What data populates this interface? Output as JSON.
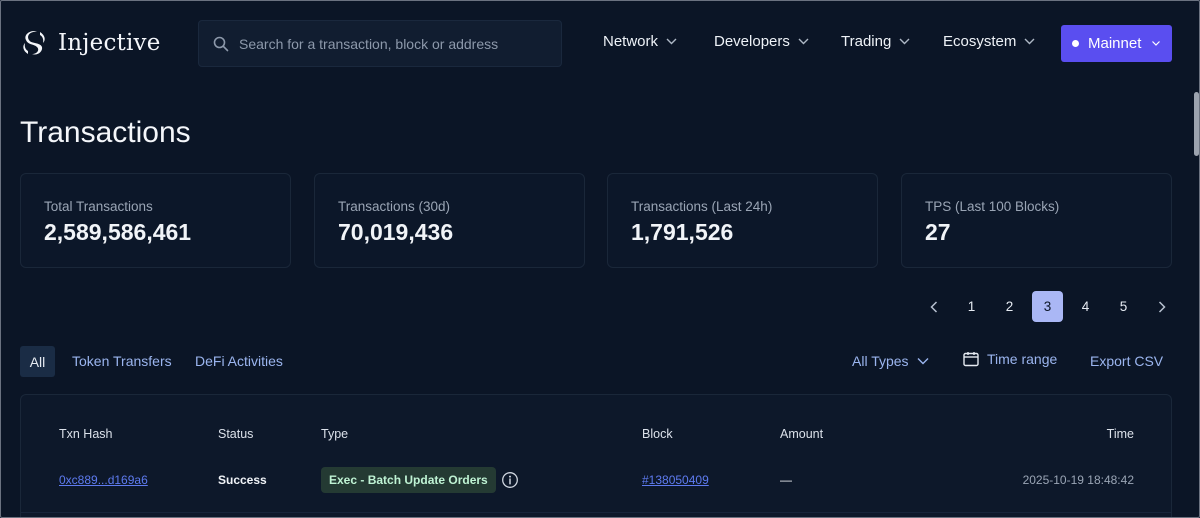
{
  "header": {
    "logo_text": "Injective",
    "search_placeholder": "Search for a transaction, block or address",
    "nav": [
      {
        "label": "Network"
      },
      {
        "label": "Developers"
      },
      {
        "label": "Trading"
      },
      {
        "label": "Ecosystem"
      }
    ],
    "network_button": "Mainnet"
  },
  "page_title": "Transactions",
  "stats": [
    {
      "label": "Total Transactions",
      "value": "2,589,586,461"
    },
    {
      "label": "Transactions (30d)",
      "value": "70,019,436"
    },
    {
      "label": "Transactions (Last 24h)",
      "value": "1,791,526"
    },
    {
      "label": "TPS (Last 100 Blocks)",
      "value": "27"
    }
  ],
  "pagination": {
    "pages": [
      "1",
      "2",
      "3",
      "4",
      "5"
    ],
    "current": "3"
  },
  "tabs": [
    "All",
    "Token Transfers",
    "DeFi Activities"
  ],
  "filters": {
    "types": "All Types",
    "time_range": "Time range",
    "export": "Export CSV"
  },
  "table": {
    "columns": {
      "hash": "Txn Hash",
      "status": "Status",
      "type": "Type",
      "block": "Block",
      "amount": "Amount",
      "time": "Time"
    },
    "rows": [
      {
        "hash": "0xc889...d169a6",
        "status": "Success",
        "type": "Exec - Batch Update Orders",
        "block": "#138050409",
        "amount": "—",
        "time": "2025-10-19 18:48:42"
      }
    ]
  },
  "colors": {
    "background": "#0b1526",
    "accent": "#5a4ef0",
    "link": "#5e7bf0",
    "active_page": "#aab7f5"
  }
}
